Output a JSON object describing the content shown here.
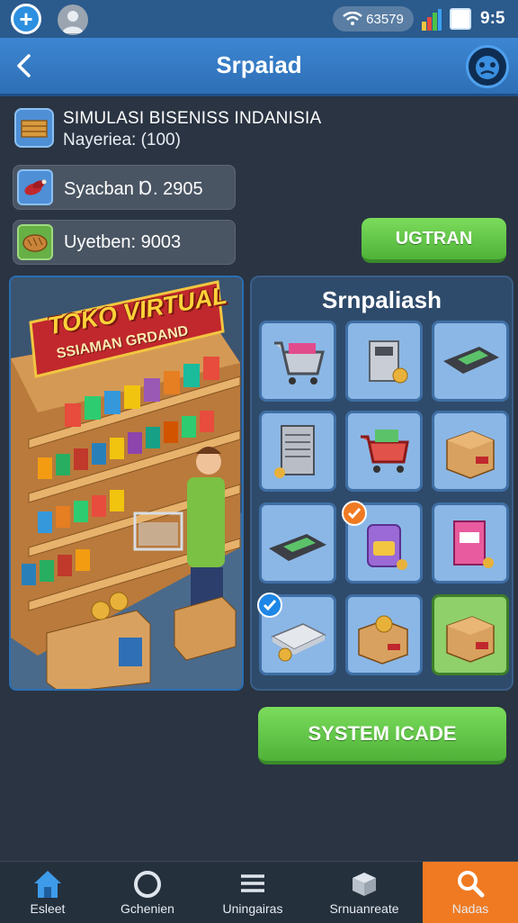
{
  "status_bar": {
    "signal_text": "63579",
    "time": "9:5"
  },
  "header": {
    "title": "Srpaiad",
    "back_icon": "chevron-left-icon",
    "profile_icon": "mascot-face-icon"
  },
  "business": {
    "title": "SIMULASI BISENISS INDANISIA",
    "subtitle": "Nayeriea: (100)"
  },
  "stats": [
    {
      "icon": "meat-icon",
      "text": "Syacban Ɒ. 2905"
    },
    {
      "icon": "bread-icon",
      "text": "Uyetben: 9003"
    }
  ],
  "upgrade_button": {
    "label": "UGTRAN"
  },
  "store_sign": {
    "title": "TOKO VIRTUAL",
    "subtitle": "SSIAMAN GRDAND"
  },
  "grid": {
    "title": "Srnpaliash",
    "items": [
      {
        "icon": "shopping-cart-icon",
        "selected": false,
        "checked": false
      },
      {
        "icon": "cash-register-icon",
        "selected": false,
        "checked": false
      },
      {
        "icon": "card-reader-icon",
        "selected": false,
        "checked": false
      },
      {
        "icon": "server-rack-icon",
        "selected": false,
        "checked": false
      },
      {
        "icon": "red-cart-icon",
        "selected": false,
        "checked": false
      },
      {
        "icon": "cardboard-box-icon",
        "selected": false,
        "checked": false
      },
      {
        "icon": "card-terminal-icon",
        "selected": false,
        "checked": false
      },
      {
        "icon": "purple-backpack-icon",
        "selected": false,
        "checked": true
      },
      {
        "icon": "pink-package-icon",
        "selected": false,
        "checked": false
      },
      {
        "icon": "cash-stack-icon",
        "selected": false,
        "checked": true
      },
      {
        "icon": "coin-box-icon",
        "selected": false,
        "checked": false
      },
      {
        "icon": "box-icon",
        "selected": true,
        "checked": false
      }
    ]
  },
  "system_button": {
    "label": "SYSTEM ICADE"
  },
  "nav": [
    {
      "icon": "home-icon",
      "label": "Esleet",
      "active": false
    },
    {
      "icon": "ring-icon",
      "label": "Gchenien",
      "active": false
    },
    {
      "icon": "list-icon",
      "label": "Uningairas",
      "active": false
    },
    {
      "icon": "box-stack-icon",
      "label": "Srnuanreate",
      "active": false
    },
    {
      "icon": "search-icon",
      "label": "Nadas",
      "active": true
    }
  ],
  "colors": {
    "header_blue": "#3d86d2",
    "green_button": "#5fc446",
    "nav_active": "#f07a22",
    "background": "#2a3442"
  }
}
